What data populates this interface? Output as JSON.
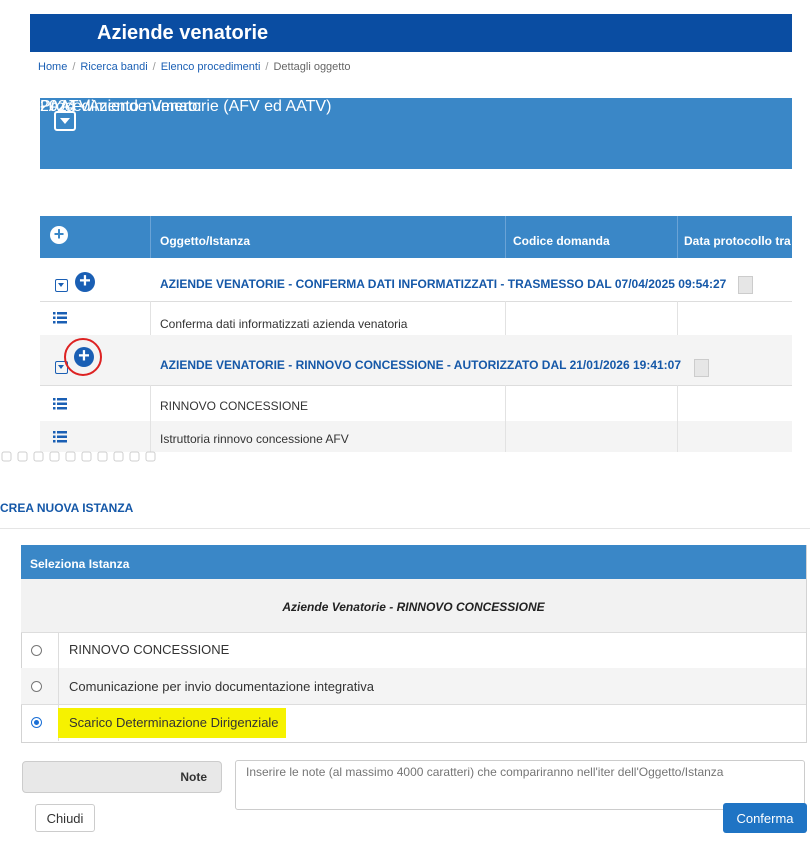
{
  "header": {
    "title": "Aziende venatorie"
  },
  "breadcrumb": [
    "Home",
    "Ricerca bandi",
    "Elenco procedimenti",
    "Dettagli oggetto"
  ],
  "procedure": {
    "line1": "- AATV",
    "line2": "2024 - Aziende Venatorie (AFV ed AATV)",
    "line3": "Procedimento numero:"
  },
  "table": {
    "columns": [
      "Oggetto/Istanza",
      "Codice domanda",
      "Data protocollo tra"
    ],
    "rows": [
      {
        "type": "group",
        "text": "AZIENDE VENATORIE - CONFERMA DATI INFORMATIZZATI - TRASMESSO DAL 07/04/2025 09:54:27"
      },
      {
        "type": "item",
        "text": "Conferma dati informatizzati azienda venatoria"
      },
      {
        "type": "group",
        "text": "AZIENDE VENATORIE - RINNOVO CONCESSIONE - AUTORIZZATO DAL 21/01/2026 19:41:07"
      },
      {
        "type": "item",
        "text": "RINNOVO CONCESSIONE"
      },
      {
        "type": "item",
        "text": "Istruttoria rinnovo concessione AFV"
      }
    ]
  },
  "create": {
    "title": "CREA NUOVA ISTANZA",
    "panel_title": "Seleziona Istanza",
    "subtitle": "Aziende Venatorie - RINNOVO CONCESSIONE",
    "options": [
      {
        "label": "RINNOVO CONCESSIONE",
        "selected": false
      },
      {
        "label": "Comunicazione per invio documentazione integrativa",
        "selected": false
      },
      {
        "label": "Scarico Determinazione Dirigenziale",
        "selected": true
      }
    ],
    "note_label": "Note",
    "note_placeholder": "Inserire le note (al massimo 4000 caratteri) che compariranno nell'iter dell'Oggetto/Istanza",
    "close_label": "Chiudi",
    "confirm_label": "Conferma"
  },
  "colors": {
    "header": "#0a4da2",
    "panel": "#3a87c7",
    "link": "#1558a8",
    "highlight": "#f6f200",
    "annotation": "#dd2222"
  },
  "icons": [
    "toggle-icon",
    "plus-icon",
    "list-icon",
    "document-icon",
    "radio-icon"
  ]
}
